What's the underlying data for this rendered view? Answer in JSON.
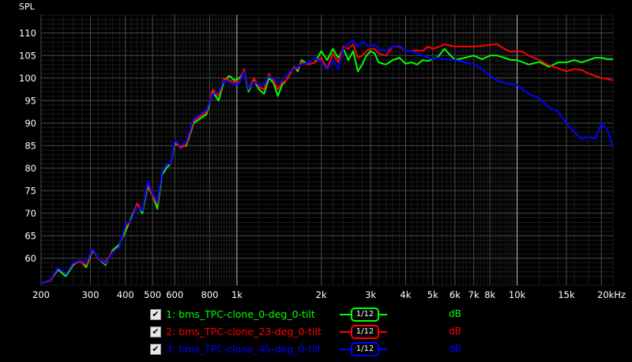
{
  "chart_data": {
    "type": "line",
    "ylabel": "SPL",
    "x_scale": "log",
    "xlim": [
      200,
      22000
    ],
    "ylim": [
      54,
      114
    ],
    "x_ticks": [
      200,
      300,
      400,
      500,
      600,
      800,
      1000,
      2000,
      3000,
      4000,
      5000,
      6000,
      7000,
      8000,
      10000,
      15000,
      20000
    ],
    "x_tick_labels": [
      "200",
      "300",
      "400",
      "500",
      "600",
      "800",
      "1k",
      "2k",
      "3k",
      "4k",
      "5k",
      "6k",
      "7k",
      "8k",
      "10k",
      "15k",
      "20kHz"
    ],
    "y_ticks": [
      60,
      65,
      70,
      75,
      80,
      85,
      90,
      95,
      100,
      105,
      110
    ],
    "grid": true,
    "background": "#000000",
    "series": [
      {
        "name": "1: bms_TPC-clone_0-deg_0-tilt",
        "color": "#00ff00",
        "x": [
          200,
          215,
          230,
          245,
          260,
          275,
          290,
          305,
          320,
          340,
          360,
          380,
          400,
          420,
          440,
          460,
          480,
          500,
          520,
          540,
          560,
          580,
          600,
          630,
          660,
          700,
          740,
          780,
          820,
          860,
          900,
          940,
          980,
          1020,
          1060,
          1100,
          1150,
          1200,
          1250,
          1300,
          1350,
          1400,
          1450,
          1500,
          1550,
          1600,
          1650,
          1700,
          1800,
          1900,
          2000,
          2100,
          2200,
          2300,
          2400,
          2500,
          2600,
          2700,
          2800,
          2900,
          3000,
          3100,
          3200,
          3400,
          3600,
          3800,
          4000,
          4200,
          4400,
          4600,
          4800,
          5000,
          5200,
          5500,
          6000,
          6500,
          7000,
          7500,
          8000,
          8500,
          9000,
          9500,
          10000,
          10500,
          11000,
          12000,
          13000,
          14000,
          15000,
          16000,
          17000,
          18000,
          19000,
          20000,
          21000,
          22000
        ],
        "values": [
          54.5,
          55,
          57.5,
          56,
          58.5,
          59.5,
          58,
          61.8,
          60,
          58.5,
          61.8,
          63,
          66,
          69,
          72,
          70,
          76,
          74,
          71,
          78.5,
          80,
          81,
          85.5,
          84.8,
          85,
          90,
          91,
          92,
          97,
          95,
          99.5,
          100.5,
          99.5,
          100,
          101.5,
          97,
          99.5,
          97.5,
          96.5,
          100,
          99,
          96,
          98.5,
          99.5,
          101,
          102.5,
          101.5,
          104,
          103,
          103.5,
          106,
          104,
          106.5,
          104.5,
          106.5,
          104,
          106,
          101.5,
          103,
          105,
          106,
          105.5,
          103.5,
          103,
          104,
          104.5,
          103.2,
          103.5,
          103,
          104,
          103.8,
          104.2,
          104.6,
          106.5,
          104,
          104.5,
          105,
          104.2,
          105,
          105,
          104.5,
          104,
          104,
          103.5,
          103,
          103.6,
          102.5,
          103.5,
          103.5,
          104,
          103.5,
          104,
          104.5,
          104.5,
          104.2,
          104.2
        ]
      },
      {
        "name": "2: bms_TPC-clone_23-deg_0-tilt",
        "color": "#ff0000",
        "x": [
          200,
          215,
          230,
          245,
          260,
          275,
          290,
          305,
          320,
          340,
          360,
          380,
          400,
          420,
          440,
          460,
          480,
          500,
          520,
          540,
          560,
          580,
          600,
          630,
          660,
          700,
          740,
          780,
          820,
          860,
          900,
          940,
          980,
          1020,
          1060,
          1100,
          1150,
          1200,
          1250,
          1300,
          1350,
          1400,
          1450,
          1500,
          1550,
          1600,
          1650,
          1700,
          1800,
          1900,
          2000,
          2100,
          2200,
          2300,
          2400,
          2500,
          2600,
          2700,
          2800,
          2900,
          3000,
          3100,
          3200,
          3400,
          3600,
          3800,
          4000,
          4200,
          4400,
          4600,
          4800,
          5000,
          5200,
          5500,
          6000,
          6500,
          7000,
          7500,
          8000,
          8500,
          9000,
          9500,
          10000,
          10500,
          11000,
          12000,
          13000,
          14000,
          15000,
          16000,
          17000,
          18000,
          19000,
          20000,
          21000,
          22000
        ],
        "values": [
          54.5,
          55,
          57.8,
          56.5,
          58.8,
          59.2,
          58.5,
          62,
          59.8,
          59.2,
          61.5,
          62.5,
          67,
          68.5,
          72.2,
          70.5,
          76.5,
          74,
          72,
          79,
          80.8,
          81,
          86,
          84.5,
          85.3,
          90.5,
          91.5,
          92.5,
          97.5,
          96,
          100,
          99.5,
          99,
          99.2,
          102,
          97.5,
          100,
          98,
          97.5,
          101,
          99.5,
          97.5,
          99,
          99.5,
          101,
          102.5,
          102,
          103.5,
          103,
          103.5,
          104.5,
          102,
          105.5,
          103.5,
          107,
          106.5,
          107.5,
          104.5,
          105,
          106,
          106.5,
          106.5,
          105.5,
          105,
          107,
          107,
          106,
          106,
          106.2,
          106,
          107,
          106.5,
          106.8,
          107.5,
          107,
          107,
          107,
          107.1,
          107.4,
          107.5,
          106.5,
          105.8,
          106,
          105.8,
          105,
          104,
          102.8,
          102.2,
          101.5,
          102,
          101.8,
          101,
          100.5,
          100,
          99.8,
          99.5
        ]
      },
      {
        "name": "3: bms_TPC-clone_45-deg_0-tilt",
        "color": "#0000ff",
        "x": [
          200,
          215,
          230,
          245,
          260,
          275,
          290,
          305,
          320,
          340,
          360,
          380,
          400,
          420,
          440,
          460,
          480,
          500,
          520,
          540,
          560,
          580,
          600,
          630,
          660,
          700,
          740,
          780,
          820,
          860,
          900,
          940,
          980,
          1020,
          1060,
          1100,
          1150,
          1200,
          1250,
          1300,
          1350,
          1400,
          1450,
          1500,
          1550,
          1600,
          1650,
          1700,
          1800,
          1900,
          2000,
          2100,
          2200,
          2300,
          2400,
          2500,
          2600,
          2700,
          2800,
          2900,
          3000,
          3100,
          3200,
          3400,
          3600,
          3800,
          4000,
          4200,
          4400,
          4600,
          4800,
          5000,
          5200,
          5500,
          6000,
          6500,
          7000,
          7500,
          8000,
          8500,
          9000,
          9500,
          10000,
          10500,
          11000,
          12000,
          13000,
          14000,
          15000,
          16000,
          17000,
          18000,
          19000,
          20000,
          21000,
          22000
        ],
        "values": [
          54.5,
          55.2,
          58,
          56.5,
          59,
          59.5,
          59,
          62.2,
          60,
          58.8,
          61.2,
          62.5,
          67.5,
          68.5,
          71.5,
          70.5,
          77.2,
          74.5,
          72.5,
          79,
          81,
          81,
          86.2,
          85,
          86,
          91,
          92,
          93,
          96.5,
          97,
          99.5,
          99,
          98.5,
          98.8,
          101.5,
          97.5,
          99.2,
          98.5,
          98.5,
          100.5,
          100,
          99,
          99.5,
          100.5,
          101.5,
          102,
          102.5,
          103,
          103.5,
          104.5,
          103.5,
          101.8,
          104,
          102,
          106.5,
          107.5,
          108.5,
          107,
          108,
          107.5,
          107,
          107.5,
          106.5,
          106,
          107,
          107.2,
          106,
          106,
          105.5,
          105,
          104.5,
          104.2,
          104.5,
          104.2,
          104,
          103.5,
          103,
          102,
          100.5,
          99.5,
          99,
          98.6,
          98.5,
          97.5,
          96.5,
          95.5,
          93.5,
          92.5,
          90,
          88,
          86.5,
          87,
          86.5,
          90,
          88.5,
          84.5
        ]
      }
    ],
    "legend": [
      {
        "index": "1:",
        "label": "bms_TPC-clone_0-deg_0-tilt",
        "smoothing": "1/12",
        "unit": "dB",
        "checked": true,
        "color": "#00ff00"
      },
      {
        "index": "2:",
        "label": "bms_TPC-clone_23-deg_0-tilt",
        "smoothing": "1/12",
        "unit": "dB",
        "checked": true,
        "color": "#ff0000"
      },
      {
        "index": "3:",
        "label": "bms_TPC-clone_45-deg_0-tilt",
        "smoothing": "1/12",
        "unit": "dB",
        "checked": true,
        "color": "#0000ff"
      }
    ]
  }
}
